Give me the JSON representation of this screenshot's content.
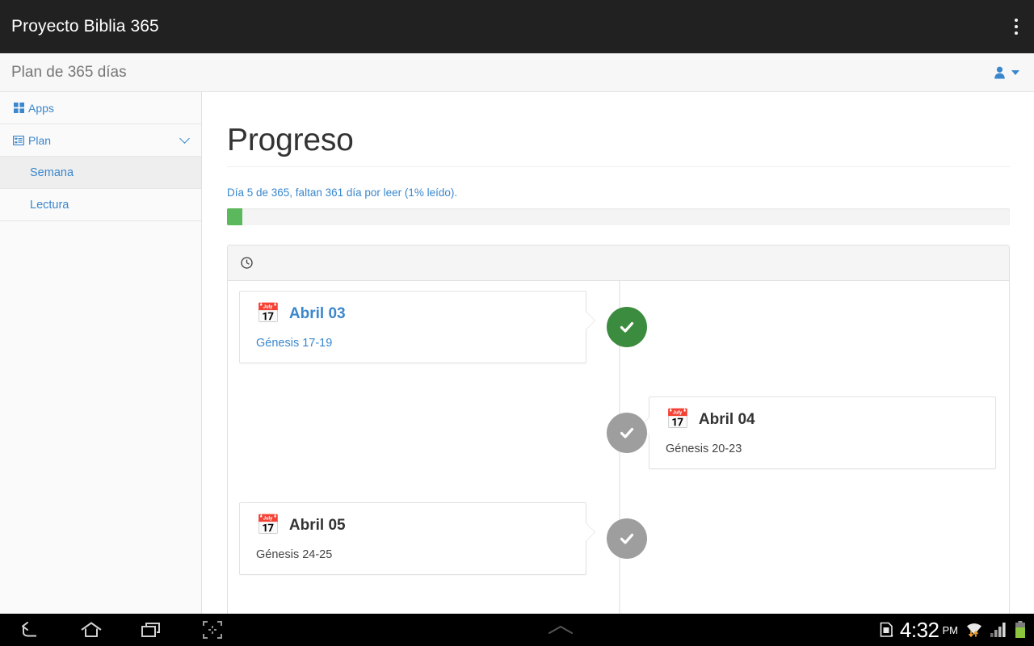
{
  "appbar": {
    "title": "Proyecto Biblia 365",
    "overflow_label": "more-options"
  },
  "subheader": {
    "title": "Plan de 365 días"
  },
  "sidebar": {
    "items": [
      {
        "label": "Apps",
        "icon": "grid-icon",
        "level": "top",
        "active": false,
        "chevron": false
      },
      {
        "label": "Plan",
        "icon": "list-alt-icon",
        "level": "top",
        "active": false,
        "chevron": true
      },
      {
        "label": "Semana",
        "icon": "",
        "level": "sub",
        "active": true,
        "chevron": false
      },
      {
        "label": "Lectura",
        "icon": "",
        "level": "sub",
        "active": false,
        "chevron": false
      }
    ]
  },
  "main": {
    "page_title": "Progreso",
    "progress_text": "Día 5 de 365, faltan 361 día por leer (1% leído).",
    "progress_percent": 2,
    "panel": {
      "heading_icon": "clock-icon",
      "entries": [
        {
          "side": "left",
          "date": "Abril 03",
          "reference": "Génesis 17-19",
          "status": "done",
          "icon": "calendar-icon",
          "badge_icon": "check-icon"
        },
        {
          "side": "right",
          "date": "Abril 04",
          "reference": "Génesis 20-23",
          "status": "pending",
          "icon": "calendar-icon",
          "badge_icon": "check-icon"
        },
        {
          "side": "left",
          "date": "Abril 05",
          "reference": "Génesis 24-25",
          "status": "pending",
          "icon": "calendar-icon",
          "badge_icon": "check-icon"
        }
      ]
    }
  },
  "navbar": {
    "buttons": [
      "back-icon",
      "home-icon",
      "recents-icon",
      "screenshot-icon"
    ],
    "handle_icon": "chevron-up-icon",
    "status": {
      "sim_icon": "sim-card-icon",
      "time": "4:32",
      "meridiem": "PM",
      "wifi_icon": "wifi-icon",
      "signal_icon": "signal-icon",
      "battery_icon": "battery-icon"
    }
  },
  "colors": {
    "accent_blue": "#3a87cd",
    "progress_green": "#5cb85c",
    "badge_done": "#3c8c3f",
    "badge_pending": "#9e9e9e",
    "appbar_dark": "#212121"
  }
}
